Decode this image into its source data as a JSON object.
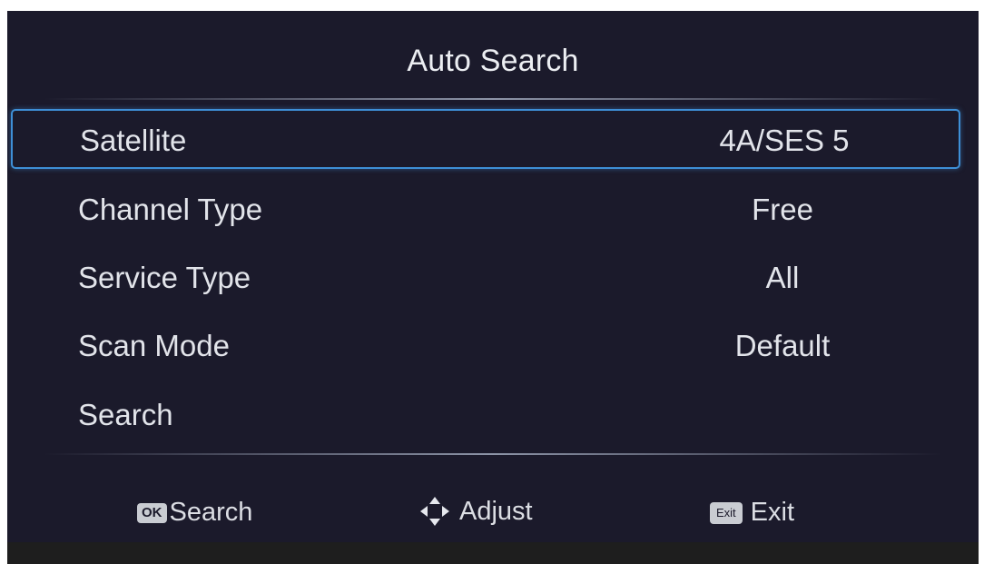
{
  "menu": {
    "title": "Auto Search",
    "rows": [
      {
        "label": "Satellite",
        "value": "4A/SES 5",
        "selected": true
      },
      {
        "label": "Channel Type",
        "value": "Free"
      },
      {
        "label": "Service Type",
        "value": "All"
      },
      {
        "label": "Scan Mode",
        "value": "Default"
      },
      {
        "label": "Search",
        "value": ""
      }
    ]
  },
  "footer": {
    "ok_key": "OK",
    "ok_label": "Search",
    "adjust_icon": "dpad-icon",
    "adjust_label": "Adjust",
    "exit_key": "Exit",
    "exit_label": "Exit"
  },
  "colors": {
    "background": "#1b1a2b",
    "selection_border": "#3e8fd6",
    "text": "#e2e4ea"
  }
}
